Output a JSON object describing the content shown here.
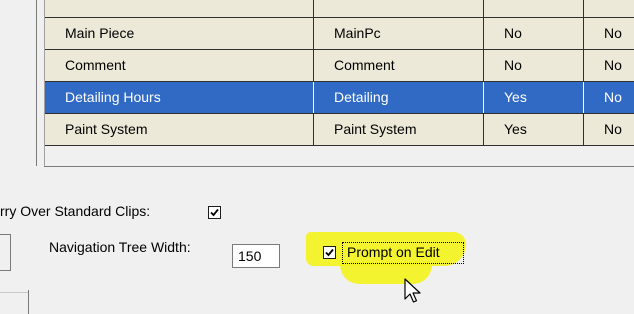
{
  "grid": {
    "rows": [
      {
        "name": "Main Piece",
        "code": "MainPc",
        "flag1": "No",
        "flag2": "No",
        "selected": false
      },
      {
        "name": "Comment",
        "code": "Comment",
        "flag1": "No",
        "flag2": "No",
        "selected": false
      },
      {
        "name": "Detailing Hours",
        "code": "Detailing",
        "flag1": "Yes",
        "flag2": "No",
        "selected": true
      },
      {
        "name": "Paint System",
        "code": "Paint System",
        "flag1": "Yes",
        "flag2": "No",
        "selected": false
      }
    ]
  },
  "options": {
    "carry_over_label": "rry Over Standard Clips:",
    "carry_over_checked": true,
    "nav_width_label": "Navigation Tree Width:",
    "nav_width_value": "150",
    "prompt_on_edit_label": "Prompt on Edit",
    "prompt_on_edit_checked": true
  },
  "colors": {
    "selection": "#316ac5",
    "row_bg": "#ece9d8",
    "highlight": "#f3f320"
  },
  "icons": {
    "cursor": "mouse-pointer-icon",
    "checkmark": "checkmark-icon"
  }
}
